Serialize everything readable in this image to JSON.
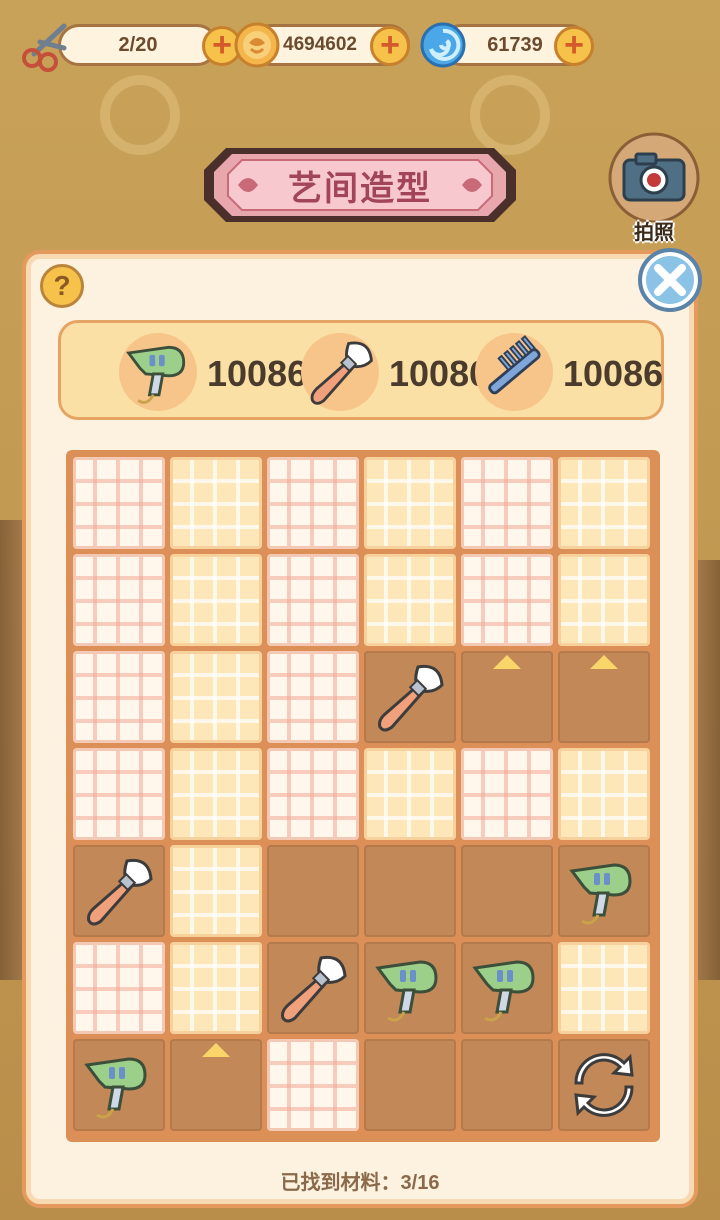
{
  "hud": {
    "scissors": {
      "value": "2/20",
      "icon": "scissors-icon"
    },
    "coins": {
      "value": "4694602",
      "icon": "coin-icon"
    },
    "gems": {
      "value": "61739",
      "icon": "blue-swirl-icon"
    },
    "plus_label": "+"
  },
  "banner": {
    "title": "艺间造型"
  },
  "camera": {
    "label": "拍照"
  },
  "help_label": "?",
  "targets": [
    {
      "icon": "hair-dryer-icon",
      "count": "10086"
    },
    {
      "icon": "makeup-brush-icon",
      "count": "10086"
    },
    {
      "icon": "comb-icon",
      "count": "10086"
    }
  ],
  "grid": {
    "rows": 7,
    "cols": 6,
    "cells": [
      [
        "w",
        "y",
        "w",
        "y",
        "w",
        "y"
      ],
      [
        "w",
        "y",
        "w",
        "y",
        "w",
        "y"
      ],
      [
        "w",
        "y",
        "w",
        "brush",
        "hint",
        "hint"
      ],
      [
        "w",
        "y",
        "w",
        "y",
        "w",
        "y"
      ],
      [
        "brush",
        "y",
        "open",
        "open",
        "open",
        "dryer"
      ],
      [
        "w",
        "y",
        "brush",
        "dryer",
        "dryer",
        "y"
      ],
      [
        "dryer",
        "hint",
        "w",
        "open",
        "open",
        "refresh"
      ]
    ]
  },
  "status": {
    "text": "已找到材料：3/16"
  },
  "colors": {
    "accent": "#e39a5c",
    "panel": "#fdf1df",
    "plus": "#f6c24a",
    "close": "#8bc3e6"
  }
}
